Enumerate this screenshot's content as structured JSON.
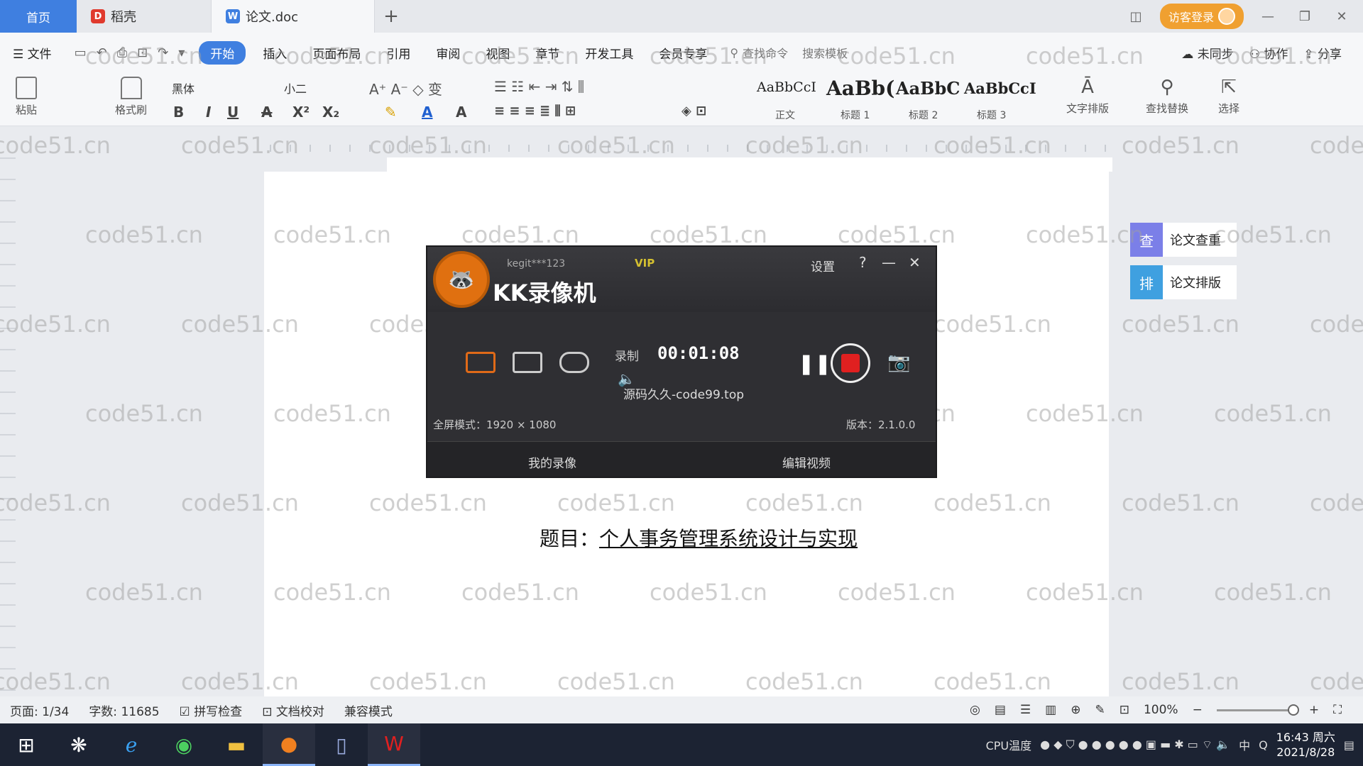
{
  "tabs": {
    "home": "首页",
    "items": [
      {
        "label": "稻壳",
        "color": "#e03a2e",
        "icon": "daoke-icon"
      },
      {
        "label": "论文.doc",
        "color": "#3f7fe0",
        "icon": "word-doc-icon"
      }
    ],
    "login_label": "访客登录"
  },
  "menu": {
    "file": "文件",
    "items": [
      "开始",
      "插入",
      "页面布局",
      "引用",
      "审阅",
      "视图",
      "章节",
      "开发工具",
      "会员专享"
    ],
    "active": "开始",
    "search_cmd": "查找命令",
    "search_template": "搜索模板",
    "right": [
      "未同步",
      "协作",
      "分享"
    ]
  },
  "ribbon": {
    "paste": "粘贴",
    "format_painter": "格式刷",
    "font": "黑体",
    "size": "小二",
    "styles": [
      {
        "preview": "AaBbCcI",
        "label": "正文"
      },
      {
        "preview": "AaBb(",
        "label": "标题 1"
      },
      {
        "preview": "AaBbC",
        "label": "标题 2"
      },
      {
        "preview": "AaBbCcI",
        "label": "标题 3"
      }
    ],
    "text_layout": "文字排版",
    "find_replace": "查找替换",
    "select": "选择"
  },
  "document": {
    "title_prefix": "题目：",
    "title": "个人事务管理系统设计与实现"
  },
  "recorder": {
    "app_name": "KK录像机",
    "user": "kegit***123",
    "vip": "VIP",
    "settings": "设置",
    "status": "录制",
    "timer": "00:01:08",
    "watermark": "源码久久-code99.top",
    "mode_info": "全屏模式：1920 × 1080",
    "version": "版本：2.1.0.0",
    "my_videos": "我的录像",
    "edit_video": "编辑视频"
  },
  "side_panel": {
    "items": [
      {
        "label": "论文查重",
        "color": "#7b7fe8"
      },
      {
        "label": "论文排版",
        "color": "#3fa0e0"
      }
    ]
  },
  "watermark_text": "code51.cn",
  "status": {
    "page": "页面: 1/34",
    "words": "字数: 11685",
    "spell": "拼写检查",
    "doc_check": "文档校对",
    "compat": "兼容模式",
    "zoom": "100%"
  },
  "taskbar": {
    "apps": [
      "start-icon",
      "cortana-icon",
      "ie-icon",
      "browser-icon",
      "explorer-icon",
      "kk-recorder-icon",
      "notepad-icon",
      "wps-icon"
    ],
    "cpu": "CPU温度",
    "ime": "中",
    "time": "16:43 周六",
    "date": "2021/8/28"
  }
}
